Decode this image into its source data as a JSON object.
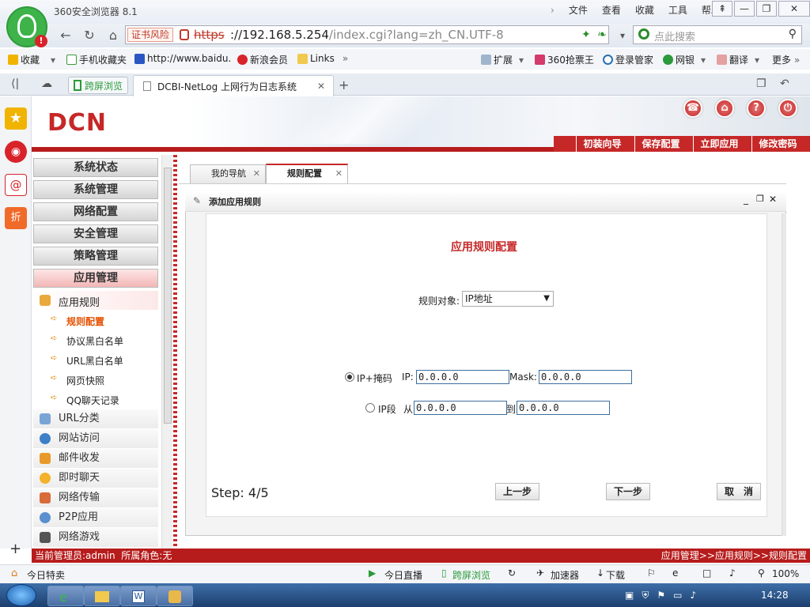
{
  "browser": {
    "app_title": "360安全浏览器 8.1",
    "top_menu": [
      "文件",
      "查看",
      "收藏",
      "工具",
      "帮助"
    ],
    "cert_warning": "证书风险",
    "url_scheme": "https",
    "url_main": "://192.168.5.254",
    "url_rest": "/index.cgi?lang=zh_CN.UTF-8",
    "search_placeholder": "点此搜索",
    "bookmarks": [
      "收藏",
      "手机收藏夹",
      "http://www.baidu.",
      "新浪会员",
      "Links"
    ],
    "bookmarks_right": [
      "扩展",
      "360抢票王",
      "登录管家",
      "网银",
      "翻译",
      "更多"
    ],
    "tabs": {
      "split": "跨屏浏览",
      "active": "DCBI-NetLog 上网行为日志系统"
    },
    "status_left": "今日特卖",
    "status_items": [
      "今日直播",
      "跨屏浏览",
      "加速器",
      "下载"
    ],
    "zoom": "100%",
    "clock": "14:28"
  },
  "header": {
    "logo": "DCN",
    "nav": [
      "初装向导",
      "保存配置",
      "立即应用",
      "修改密码"
    ]
  },
  "menu": {
    "sections": [
      "系统状态",
      "系统管理",
      "网络配置",
      "安全管理",
      "策略管理",
      "应用管理"
    ],
    "sub_head": "应用规则",
    "items": [
      "规则配置",
      "协议黑白名单",
      "URL黑白名单",
      "网页快照",
      "QQ聊天记录"
    ],
    "groups": [
      "URL分类",
      "网站访问",
      "邮件收发",
      "即时聊天",
      "网络传输",
      "P2P应用",
      "网络游戏"
    ]
  },
  "content": {
    "tabs": [
      "我的导航",
      "规则配置"
    ],
    "panel_title": "添加应用规则",
    "form_title": "应用规则配置",
    "object_label": "规则对象:",
    "object_value": "IP地址",
    "opt1_label": "IP+掩码",
    "ip_label": "IP:",
    "ip_value": "0.0.0.0",
    "mask_label": "Mask:",
    "mask_value": "0.0.0.0",
    "opt2_label": "IP段",
    "from_label": "从",
    "from_value": "0.0.0.0",
    "to_label": "到",
    "to_value": "0.0.0.0",
    "step": "Step: 4/5",
    "prev": "上一步",
    "next": "下一步",
    "cancel": "取　消"
  },
  "statusbar": {
    "left": "当前管理员:admin  所属角色:无",
    "right": "应用管理>>应用规则>>规则配置"
  }
}
